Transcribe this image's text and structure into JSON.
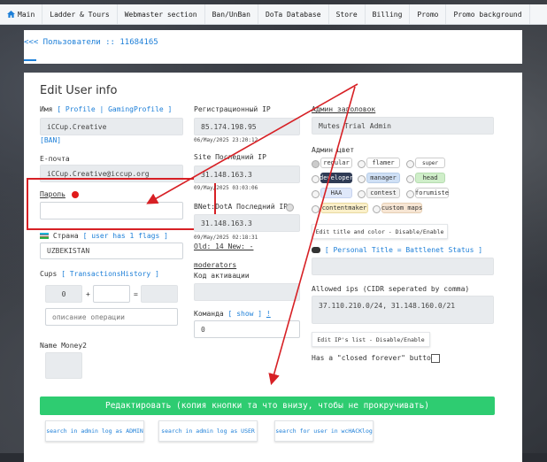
{
  "nav": {
    "items": [
      "Main",
      "Ladder & Tours",
      "Webmaster section",
      "Ban/UnBan",
      "DoTa Database",
      "Store",
      "Billing",
      "Promo",
      "Promo background"
    ]
  },
  "breadcrumb": "<<< Пользователи :: 11684165",
  "card": {
    "title": "Edit User info",
    "name_label": "Имя",
    "profile_link": "Profile",
    "gaming_profile_link": "GamingProfile",
    "name_value": "iCCup.Creative",
    "ban_link": "BAN",
    "email_label": "E-почта",
    "email_value": "iCCup.Creative@iccup.org",
    "password_label": "Пароль",
    "password_value": "",
    "country_label": "Страна",
    "flags_link": "user has 1 flags",
    "country_value": "UZBEKISTAN",
    "cups_label": "Cups",
    "transactions_link": "TransactionsHistory",
    "cups_value": "0",
    "plus": "+",
    "equals": "=",
    "operation_placeholder": "описание операции",
    "money2_label": "Name Money2",
    "reg_ip_label": "Регистрационный IP",
    "reg_ip_value": "85.174.198.95",
    "reg_ip_date": "06/May/2025 23:20:12",
    "site_ip_label": "Site Последний IP",
    "site_ip_value": "31.148.163.3",
    "site_ip_date": "09/May/2025 03:03:06",
    "bnet_ip_label": "BNet:DotA Последний IP",
    "bnet_ip_value": "31.148.163.3",
    "bnet_ip_date": "09/May/2025 02:18:31",
    "old_new": "Old: 14 New: -",
    "moderators_link": "moderators",
    "activation_label": "Код активации",
    "team_label": "Команда",
    "show_link": "show",
    "excl": "!",
    "team_value": "0",
    "admin_title_label": "Админ заголовок",
    "admin_title_value": "Mutes Trial Admin",
    "admin_color_label": "Админ цвет",
    "colors": {
      "regular": "regular",
      "flamer": "flamer",
      "super": "super",
      "developer": "developer",
      "manager": "manager",
      "head": "head",
      "haa": "HAA",
      "contest": "contest",
      "forumiste": "forumiste",
      "contentmaker": "contentmaker",
      "custom_maps": "custom maps"
    },
    "edit_title_btn": "Edit title and color - Disable/Enable",
    "personal_title_label": "Personal Title = Battlenet Status",
    "allowed_ips_label": "Allowed ips (CIDR seperated by comma)",
    "allowed_ips_value": "37.110.210.0/24, 31.148.160.0/21",
    "edit_ips_btn": "Edit IP's list - Disable/Enable",
    "closed_forever_label": "Has a \"closed forever\" button",
    "submit_btn": "Редактировать (копия кнопки та что внизу, чтобы не прокручивать)",
    "search_admin_btn": "search in admin log as ADMIN",
    "search_user_btn": "search in admin log as USER",
    "search_wchack_btn": "search for user in wcHACKlog"
  },
  "colors": {
    "accent": "#1d7fd8",
    "annotation_red": "#d72025",
    "submit_green": "#2ecc71"
  }
}
